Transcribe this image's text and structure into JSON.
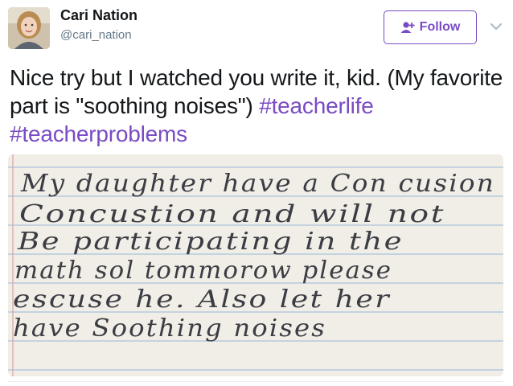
{
  "author": {
    "name": "Cari Nation",
    "handle": "@cari_nation"
  },
  "follow_button": {
    "label": "Follow"
  },
  "tweet": {
    "text_plain": "Nice try but I watched you write it, kid. (My favorite part is \"soothing noises\") ",
    "hashtags": [
      "#teacherlife",
      "#teacherproblems"
    ]
  },
  "photo": {
    "handwriting_lines": [
      "My daughter have a Con cusion",
      "Concustion and will not",
      "Be participating in the",
      "math sol tommorow please",
      "escuse he. Also let her",
      "have Soothing noises"
    ]
  },
  "colors": {
    "accent": "#794bc4",
    "name_text": "#14171a",
    "handle_text": "#657786",
    "paper": "#f4f2ec",
    "ruling": "#a9c3dc",
    "margin_line": "#d9a3a3"
  },
  "icons": {
    "follow": "add-user-icon",
    "menu": "chevron-down-icon"
  }
}
